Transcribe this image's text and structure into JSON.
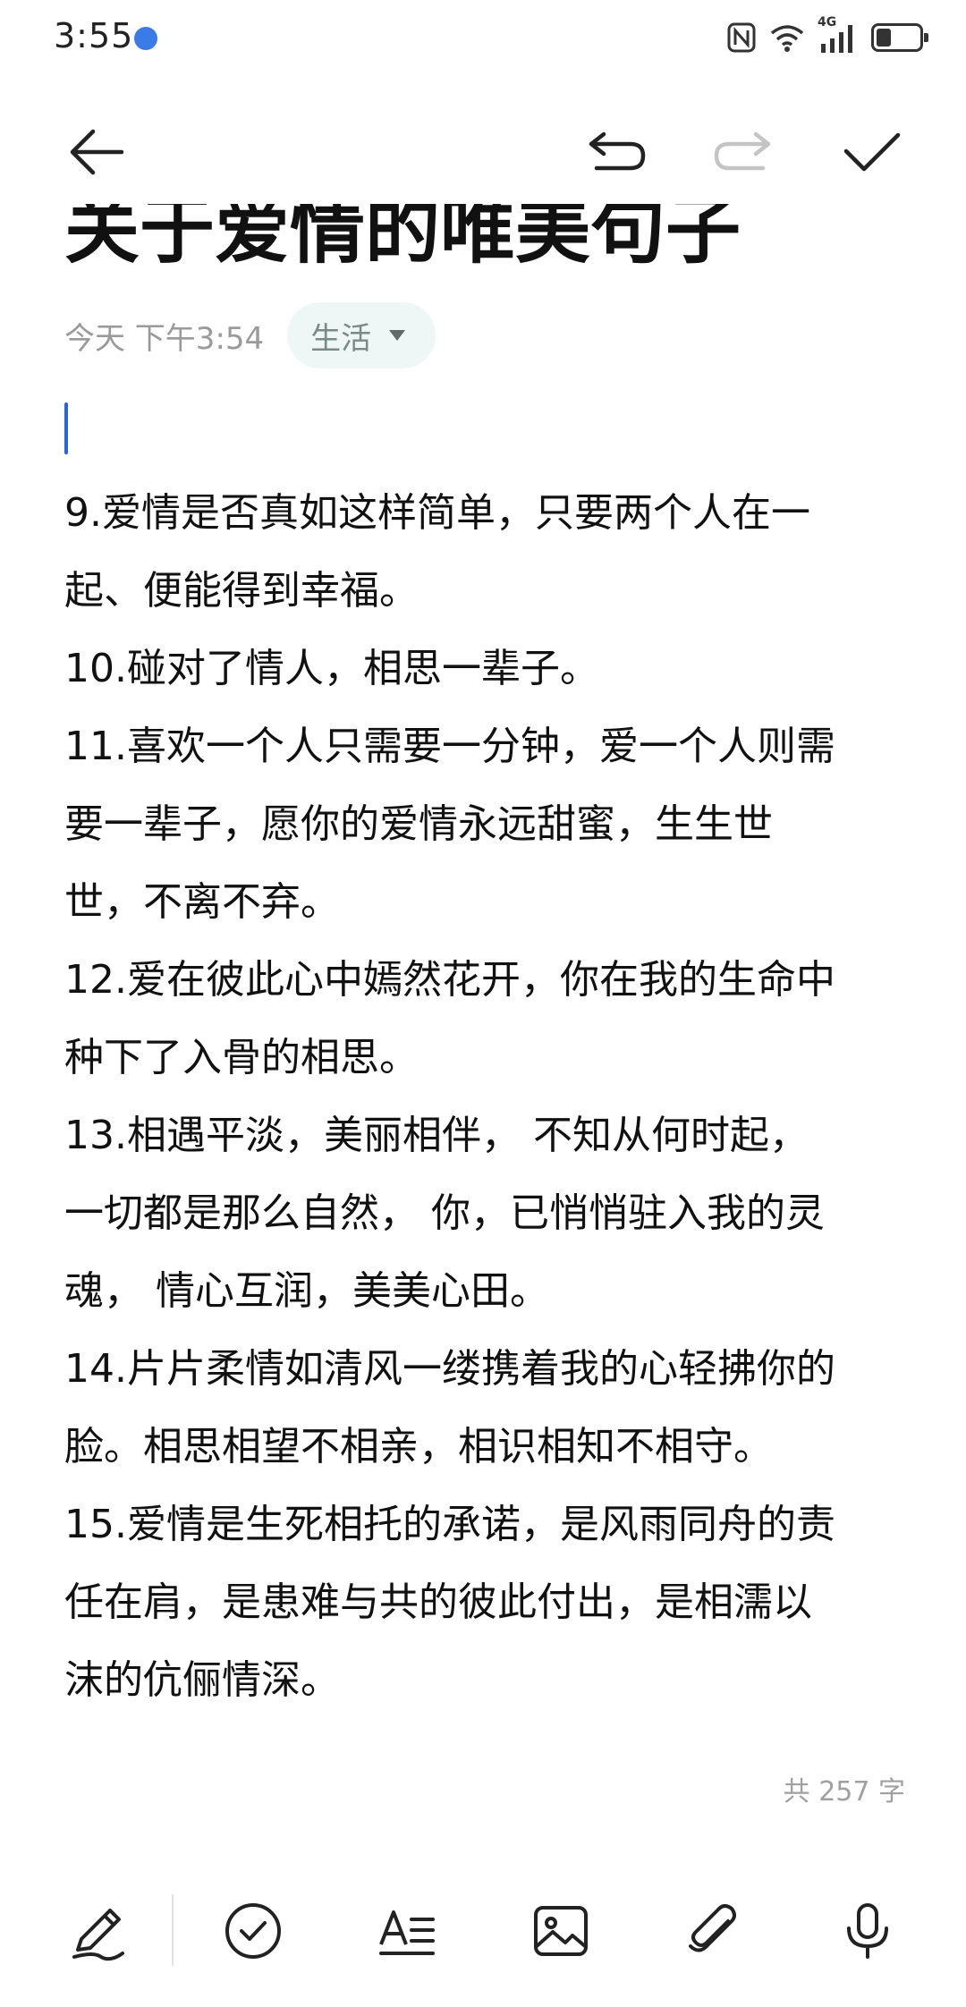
{
  "status_bar": {
    "time": "3:55",
    "network": "4G",
    "icons": [
      "location-icon",
      "nfc-icon",
      "wifi-icon",
      "signal-icon",
      "battery-icon"
    ]
  },
  "toolbar": {
    "icons": [
      "back-arrow-icon",
      "undo-icon",
      "redo-icon",
      "check-icon"
    ],
    "redo_enabled": false
  },
  "note": {
    "title": "关于爱情的唯美句子",
    "date": "今天 下午3:54",
    "category": "生活",
    "lines": [
      "9.爱情是否真如这样简单，只要两个人在一",
      "起、便能得到幸福。",
      "10.碰对了情人，相思一辈子。",
      "11.喜欢一个人只需要一分钟，爱一个人则需",
      "要一辈子，愿你的爱情永远甜蜜，生生世",
      "世，不离不弃。",
      "12.爱在彼此心中嫣然花开，你在我的生命中",
      "种下了入骨的相思。",
      "13.相遇平淡，美丽相伴， 不知从何时起，",
      "一切都是那么自然， 你，已悄悄驻入我的灵",
      "魂， 情心互润，美美心田。",
      "14.片片柔情如清风一缕携着我的心轻拂你的",
      "脸。相思相望不相亲，相识相知不相守。",
      "15.爱情是生死相托的承诺，是风雨同舟的责",
      "任在肩，是患难与共的彼此付出，是相濡以",
      "沫的伉俪情深。"
    ],
    "word_count": "共 257 字"
  },
  "bottom_bar": {
    "icons": [
      "handwriting-icon",
      "checklist-icon",
      "text-format-icon",
      "image-icon",
      "attachment-icon",
      "microphone-icon"
    ]
  },
  "colors": {
    "accent": "#2a64d8",
    "category_bg": "#eef7f5",
    "muted_text": "#9a9a9a"
  }
}
